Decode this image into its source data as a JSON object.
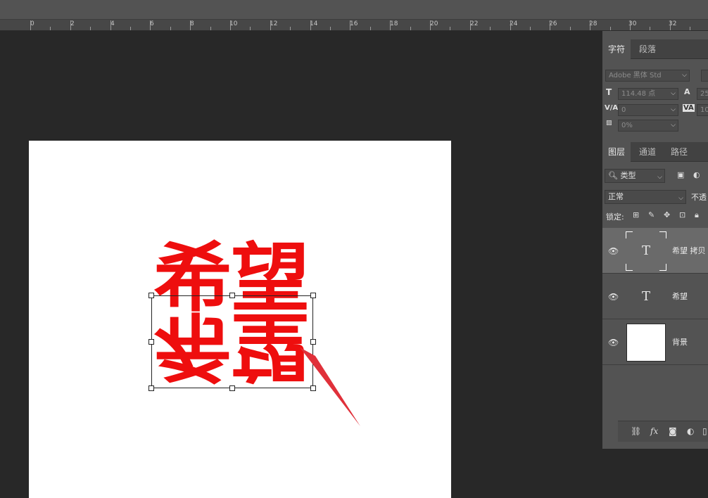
{
  "ruler": {
    "labels": [
      "0",
      "2",
      "4",
      "6",
      "8",
      "10",
      "12",
      "14",
      "16",
      "18",
      "20",
      "22",
      "24",
      "26",
      "28",
      "30",
      "32"
    ]
  },
  "canvas": {
    "chars": {
      "top_left": "希",
      "top_right": "望",
      "bottom_left": "希",
      "bottom_right": "望"
    }
  },
  "character_panel": {
    "tabs": [
      {
        "label": "字符"
      },
      {
        "label": "段落"
      }
    ],
    "font_family": "Adobe 黑体 Std",
    "font_size": "114.48 点",
    "leading_partial": "25",
    "kerning": "0",
    "tracking_partial": "10",
    "scale_percent": "0%"
  },
  "layers_panel": {
    "tabs": [
      {
        "label": "图层"
      },
      {
        "label": "通道"
      },
      {
        "label": "路径"
      }
    ],
    "filter_kind": "类型",
    "blend_mode": "正常",
    "opacity_label_partial": "不透",
    "lock_label": "锁定:",
    "layers": [
      {
        "name": "希望 拷贝",
        "thumb_glyph": "T",
        "type": "text",
        "selected": true
      },
      {
        "name": "希望",
        "thumb_glyph": "T",
        "type": "text",
        "selected": false
      },
      {
        "name": "背景",
        "thumb_glyph": "",
        "type": "background",
        "selected": false
      }
    ],
    "footer": {
      "fx_label": "fx"
    }
  },
  "colors": {
    "text_red": "#ee0e0e",
    "arrow_red": "#e0303a",
    "panel_bg": "#535353",
    "workspace_bg": "#282828"
  }
}
